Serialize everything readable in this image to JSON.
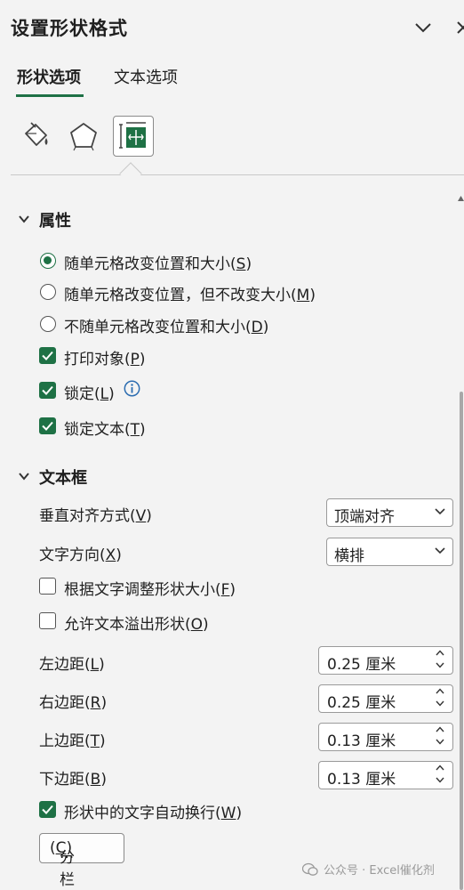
{
  "pane": {
    "title": "设置形状格式"
  },
  "tabs": [
    {
      "label": "形状选项",
      "selected": true
    },
    {
      "label": "文本选项",
      "selected": false
    }
  ],
  "icon_buttons": [
    {
      "icon": "fill-line-icon",
      "selected": false
    },
    {
      "icon": "effects-pentagon-icon",
      "selected": false
    },
    {
      "icon": "size-properties-icon",
      "selected": true
    }
  ],
  "properties": {
    "header": "属性",
    "radios": [
      {
        "label": "随单元格改变位置和大小",
        "hotkey": "S",
        "checked": true
      },
      {
        "label": "随单元格改变位置，但不改变大小",
        "hotkey": "M",
        "checked": false
      },
      {
        "label": "不随单元格改变位置和大小",
        "hotkey": "D",
        "checked": false
      }
    ],
    "checks": [
      {
        "label": "打印对象",
        "hotkey": "P",
        "checked": true
      },
      {
        "label": "锁定",
        "hotkey": "L",
        "checked": true,
        "info": true
      },
      {
        "label": "锁定文本",
        "hotkey": "T",
        "checked": true
      }
    ]
  },
  "textbox": {
    "header": "文本框",
    "vertical_align": {
      "label": "垂直对齐方式",
      "hotkey": "V",
      "value": "顶端对齐"
    },
    "text_direction": {
      "label": "文字方向",
      "hotkey": "X",
      "value": "横排"
    },
    "resize_shape": {
      "label": "根据文字调整形状大小",
      "hotkey": "F",
      "checked": false
    },
    "overflow": {
      "label": "允许文本溢出形状",
      "hotkey": "O",
      "checked": false
    },
    "margins": [
      {
        "label": "左边距",
        "hotkey": "L",
        "value": "0.25 厘米"
      },
      {
        "label": "右边距",
        "hotkey": "R",
        "value": "0.25 厘米"
      },
      {
        "label": "上边距",
        "hotkey": "T",
        "value": "0.13 厘米"
      },
      {
        "label": "下边距",
        "hotkey": "B",
        "value": "0.13 厘米"
      }
    ],
    "wrap": {
      "label": "形状中的文字自动换行",
      "hotkey": "W",
      "checked": true
    },
    "columns_button": {
      "label": "分栏",
      "hotkey": "C",
      "suffix": "..."
    }
  },
  "watermark": "公众号 · Excel催化剂",
  "colors": {
    "accent": "#1e7145",
    "info": "#2b6cb0",
    "background": "#f3f3f3"
  }
}
